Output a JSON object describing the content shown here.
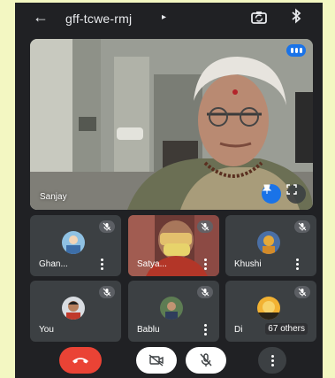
{
  "header": {
    "back_icon": "arrow-left-icon",
    "meeting_code": "gff-tcwe-rmj",
    "caret": "▸"
  },
  "main_participant": {
    "name": "Sanjay"
  },
  "tiles": [
    {
      "name": "Ghan...",
      "muted": true
    },
    {
      "name": "Satya...",
      "muted": true
    },
    {
      "name": "Khushi",
      "muted": true
    },
    {
      "name": "You",
      "muted": true
    },
    {
      "name": "Bablu",
      "muted": true
    },
    {
      "name": "Di",
      "muted": true,
      "others": "67 others"
    }
  ],
  "controls": [
    "end-call",
    "camera-off",
    "mic-off",
    "more-options"
  ],
  "colors": {
    "end_call": "#ea4335",
    "accent": "#1a73e8",
    "background": "#202124",
    "tile": "#3c4043"
  }
}
